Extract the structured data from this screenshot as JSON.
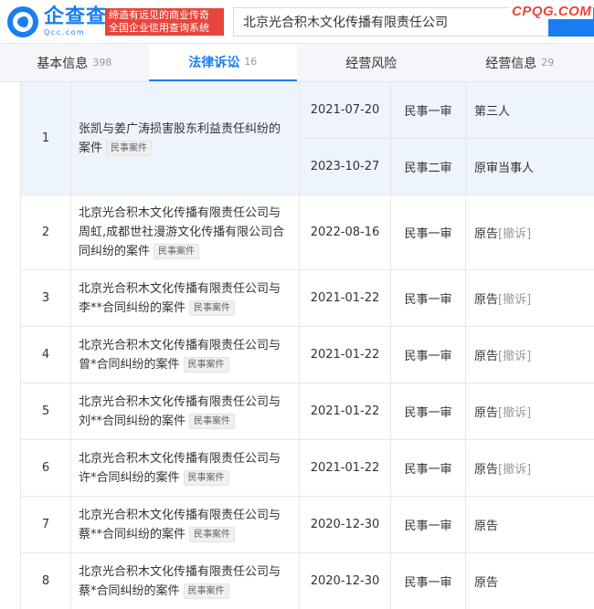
{
  "header": {
    "logo_name": "企查查",
    "logo_sub": "Qcc.com",
    "slogan_line1": "缔造有远见的商业传奇",
    "slogan_line2": "全国企业信用查询系统",
    "search_value": "北京光合积木文化传播有限责任公司",
    "watermark": "CPQG.COM"
  },
  "tabs": [
    {
      "label": "基本信息",
      "count": "398"
    },
    {
      "label": "法律诉讼",
      "count": "16"
    },
    {
      "label": "经营风险",
      "count": ""
    },
    {
      "label": "经营信息",
      "count": "29"
    }
  ],
  "case_tag": "民事案件",
  "rows": [
    {
      "num": "1",
      "title": "张凯与姜广涛损害股东利益责任纠纷的案件",
      "subs": [
        {
          "date": "2021-07-20",
          "type": "民事一审",
          "role": "第三人",
          "withdraw": ""
        },
        {
          "date": "2023-10-27",
          "type": "民事二审",
          "role": "原审当事人",
          "withdraw": ""
        }
      ]
    },
    {
      "num": "2",
      "title": "北京光合积木文化传播有限责任公司与周虹,成都世社漫游文化传播有限公司合同纠纷的案件",
      "subs": [
        {
          "date": "2022-08-16",
          "type": "民事一审",
          "role": "原告",
          "withdraw": "[撤诉]"
        }
      ]
    },
    {
      "num": "3",
      "title": "北京光合积木文化传播有限责任公司与李**合同纠纷的案件",
      "subs": [
        {
          "date": "2021-01-22",
          "type": "民事一审",
          "role": "原告",
          "withdraw": "[撤诉]"
        }
      ]
    },
    {
      "num": "4",
      "title": "北京光合积木文化传播有限责任公司与曾*合同纠纷的案件",
      "subs": [
        {
          "date": "2021-01-22",
          "type": "民事一审",
          "role": "原告",
          "withdraw": "[撤诉]"
        }
      ]
    },
    {
      "num": "5",
      "title": "北京光合积木文化传播有限责任公司与刘**合同纠纷的案件",
      "subs": [
        {
          "date": "2021-01-22",
          "type": "民事一审",
          "role": "原告",
          "withdraw": "[撤诉]"
        }
      ]
    },
    {
      "num": "6",
      "title": "北京光合积木文化传播有限责任公司与许*合同纠纷的案件",
      "subs": [
        {
          "date": "2021-01-22",
          "type": "民事一审",
          "role": "原告",
          "withdraw": "[撤诉]"
        }
      ]
    },
    {
      "num": "7",
      "title": "北京光合积木文化传播有限责任公司与蔡**合同纠纷的案件",
      "subs": [
        {
          "date": "2020-12-30",
          "type": "民事一审",
          "role": "原告",
          "withdraw": ""
        }
      ]
    },
    {
      "num": "8",
      "title": "北京光合积木文化传播有限责任公司与蔡*合同纠纷的案件",
      "subs": [
        {
          "date": "2020-12-30",
          "type": "民事一审",
          "role": "原告",
          "withdraw": ""
        }
      ]
    }
  ]
}
